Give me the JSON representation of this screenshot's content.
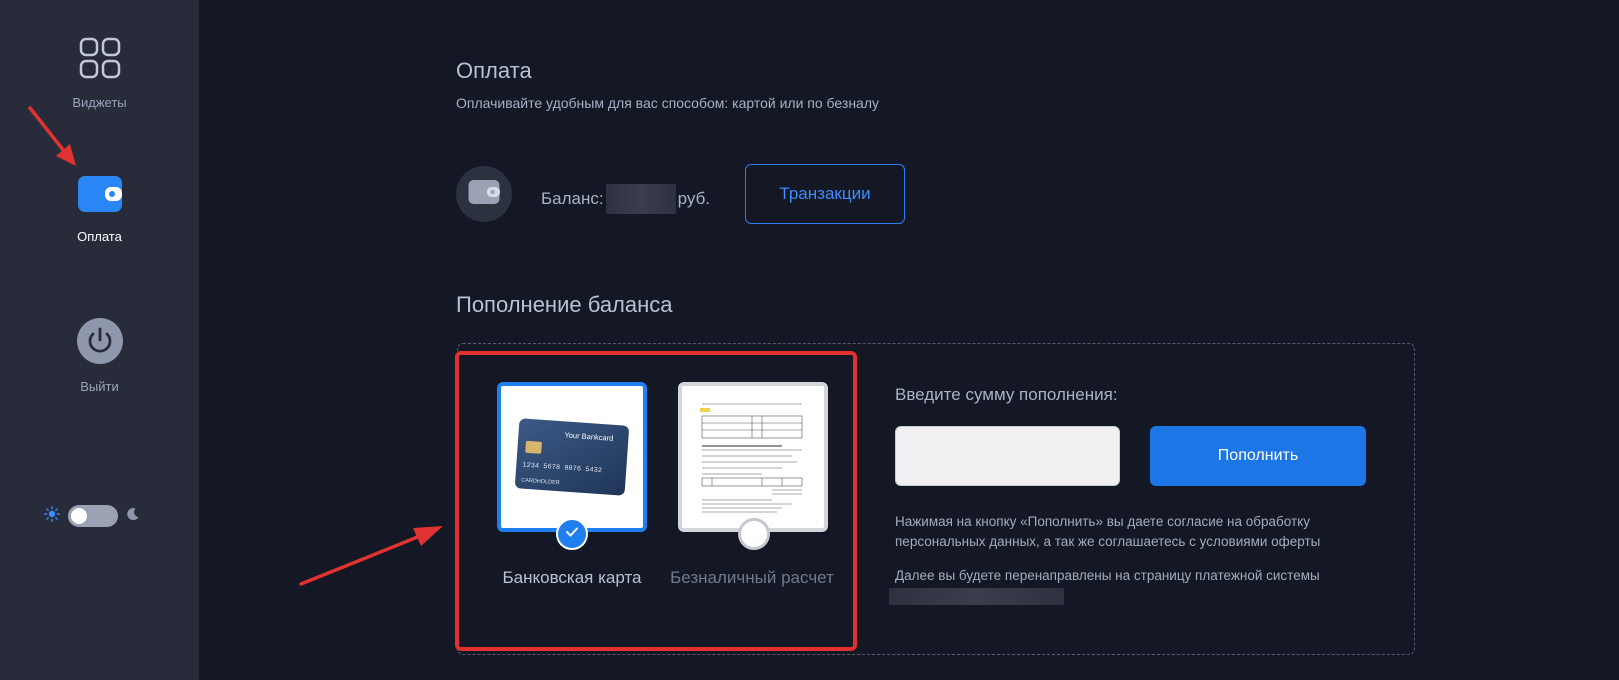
{
  "sidebar": {
    "items": [
      {
        "label": "Виджеты",
        "icon": "widgets-icon"
      },
      {
        "label": "Оплата",
        "icon": "wallet-icon",
        "active": true
      },
      {
        "label": "Выйти",
        "icon": "power-icon"
      }
    ],
    "theme": {
      "light_icon": "sun-icon",
      "dark_icon": "moon-icon",
      "mode": "light"
    }
  },
  "payment": {
    "title": "Оплата",
    "subtitle": "Оплачивайте удобным для вас способом: картой или по безналу",
    "balance_prefix": "Баланс:",
    "balance_currency": "руб.",
    "transactions_label": "Транзакции"
  },
  "topup": {
    "title": "Пополнение баланса",
    "methods": [
      {
        "label": "Банковская карта",
        "selected": true
      },
      {
        "label": "Безналичный расчет",
        "selected": false
      }
    ],
    "card_image": {
      "brand": "Your Bankcard",
      "number": "1234 5678 9876 5432",
      "holder": "CARDHOLDER"
    },
    "amount_label": "Введите сумму пополнения:",
    "amount_value": "",
    "submit_label": "Пополнить",
    "consent_text": "Нажимая на кнопку «Пополнить» вы даете согласие на обработку персональных данных, а так же соглашаетесь с условиями оферты",
    "redirect_text": "Далее вы будете перенаправлены на страницу платежной системы"
  },
  "colors": {
    "background": "#141824",
    "sidebar": "#272b3a",
    "accent": "#1c76e6",
    "highlight": "#e0322e"
  }
}
